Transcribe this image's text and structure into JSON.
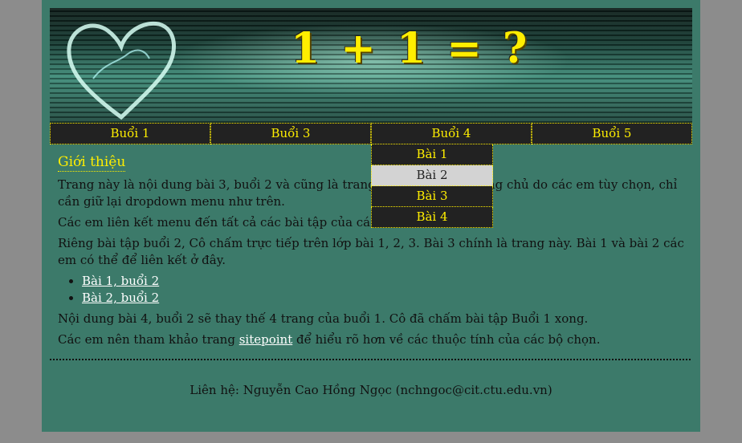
{
  "banner": {
    "title": "1 + 1 = ?"
  },
  "nav": [
    {
      "label": "Buổi 1"
    },
    {
      "label": "Buổi 3"
    },
    {
      "label": "Buổi 4"
    },
    {
      "label": "Buổi 5"
    }
  ],
  "dropdown": [
    {
      "label": "Bài 1"
    },
    {
      "label": "Bài 2"
    },
    {
      "label": "Bài 3"
    },
    {
      "label": "Bài 4"
    }
  ],
  "main": {
    "heading": "Giới thiệu",
    "p1": "Trang này là nội dung bài 3, buổi 2 và cũng là trang chủ. Nội dung trang chủ do các em tùy chọn, chỉ cần giữ lại dropdown menu như trên.",
    "p2": "Các em liên kết menu đến tất cả các bài tập của các buổi.",
    "p3": "Riêng bài tập buổi 2, Cô chấm trực tiếp trên lớp bài 1, 2, 3. Bài 3 chính là trang này. Bài 1 và bài 2 các em có thể để liên kết ở đây.",
    "links": [
      "Bài 1, buổi 2",
      "Bài 2, buổi 2"
    ],
    "p4": "Nội dung bài 4, buổi 2 sẽ thay thế 4 trang của buổi 1. Cô đã chấm bài tập Buổi 1 xong.",
    "p5_before": "Các em nên tham khảo trang ",
    "p5_link": "sitepoint",
    "p5_after": " để hiểu rõ hơn về các thuộc tính của các bộ chọn."
  },
  "footer": {
    "text": "Liên hệ: Nguyễn Cao Hồng Ngọc (nchngoc@cit.ctu.edu.vn)"
  },
  "colors": {
    "accent": "#ffee00",
    "background": "#3c7a6a",
    "menu": "#222222"
  }
}
